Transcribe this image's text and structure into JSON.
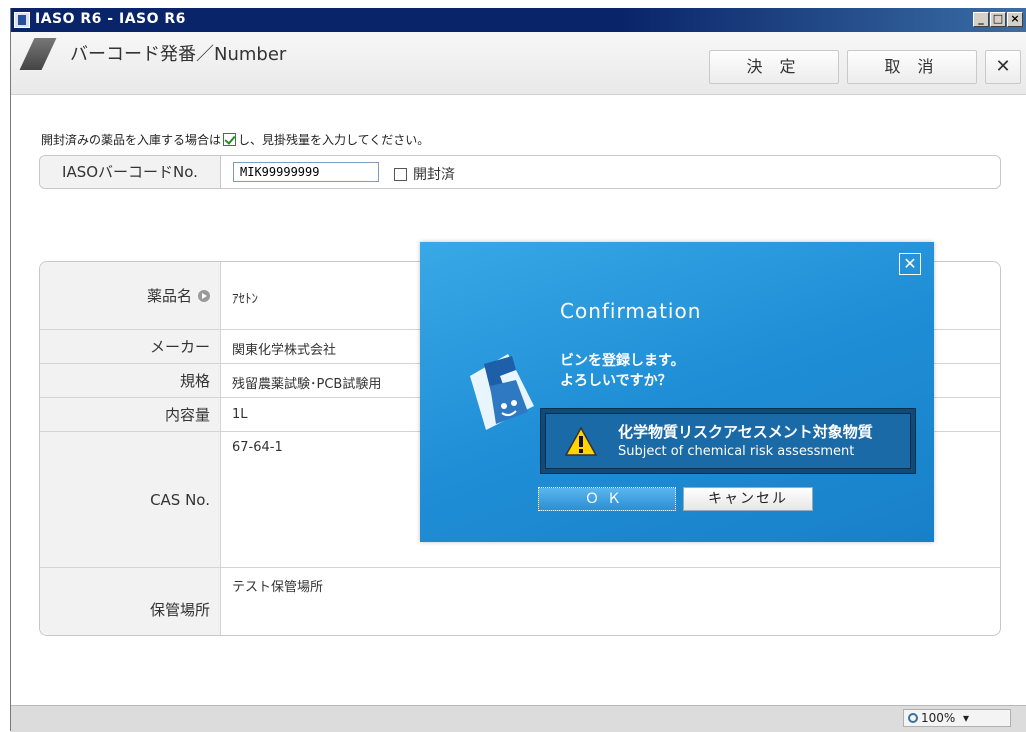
{
  "window": {
    "title": "IASO R6 - IASO R6"
  },
  "header": {
    "title": "バーコード発番／Number",
    "confirm_label": "決 定",
    "cancel_label": "取 消",
    "close_glyph": "✕"
  },
  "form": {
    "instruction_before": "開封済みの薬品を入庫する場合は",
    "instruction_after": "し、見掛残量を入力してください。",
    "barcode_label": "IASOバーコードNo.",
    "barcode_value": "MIK99999999",
    "opened_label": "開封済"
  },
  "details": {
    "rows": [
      {
        "label": "薬品名",
        "value": "ｱｾﾄﾝ"
      },
      {
        "label": "メーカー",
        "value": "関東化学株式会社"
      },
      {
        "label": "規格",
        "value": "残留農薬試験･PCB試験用"
      },
      {
        "label": "内容量",
        "value": "1L"
      },
      {
        "label": "CAS No.",
        "value": "67-64-1"
      },
      {
        "label": "保管場所",
        "value": "テスト保管場所"
      }
    ]
  },
  "dialog": {
    "title": "Confirmation",
    "message_line1": "ビンを登録します。",
    "message_line2": "よろしいですか？",
    "warning_title": "化学物質リスクアセスメント対象物質",
    "warning_subtitle": "Subject of chemical risk assessment",
    "ok_label": "ＯＫ",
    "cancel_label": "キャンセル",
    "close_glyph": "✕"
  },
  "statusbar": {
    "zoom": "100%"
  },
  "icons": {
    "app": "app-icon",
    "dialog_close": "close-icon",
    "warning": "warning-icon",
    "mascot": "flask-mascot-icon",
    "zoom": "zoom-icon"
  },
  "colors": {
    "dialog_bg": "#1f8ed6",
    "warning_bg": "#0f4a78",
    "warning_yellow": "#ffd400"
  }
}
